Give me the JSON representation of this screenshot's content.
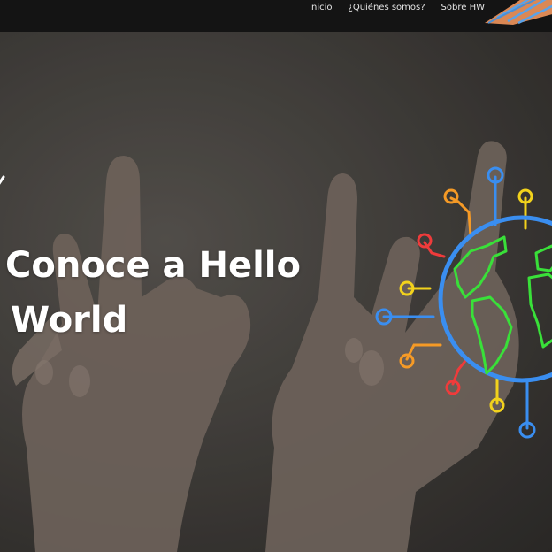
{
  "nav": {
    "items": [
      "Inicio",
      "¿Quiénes somos?",
      "Sobre HW"
    ]
  },
  "hero": {
    "title_line1": "Conoce a Hello",
    "title_line2": "World"
  },
  "colors": {
    "header_bg": "#141414",
    "logo_orange": "#f0955c",
    "logo_blue": "#5aa2e8",
    "globe_blue": "#3a8ef0",
    "globe_green": "#39e039",
    "node_red": "#ef3b3b",
    "node_orange": "#f59a26",
    "node_yellow": "#f2d21c",
    "node_blue": "#3a8ef0"
  },
  "icons": [
    "leaf-logo-icon",
    "globe-network-icon",
    "checkmark-icon"
  ]
}
